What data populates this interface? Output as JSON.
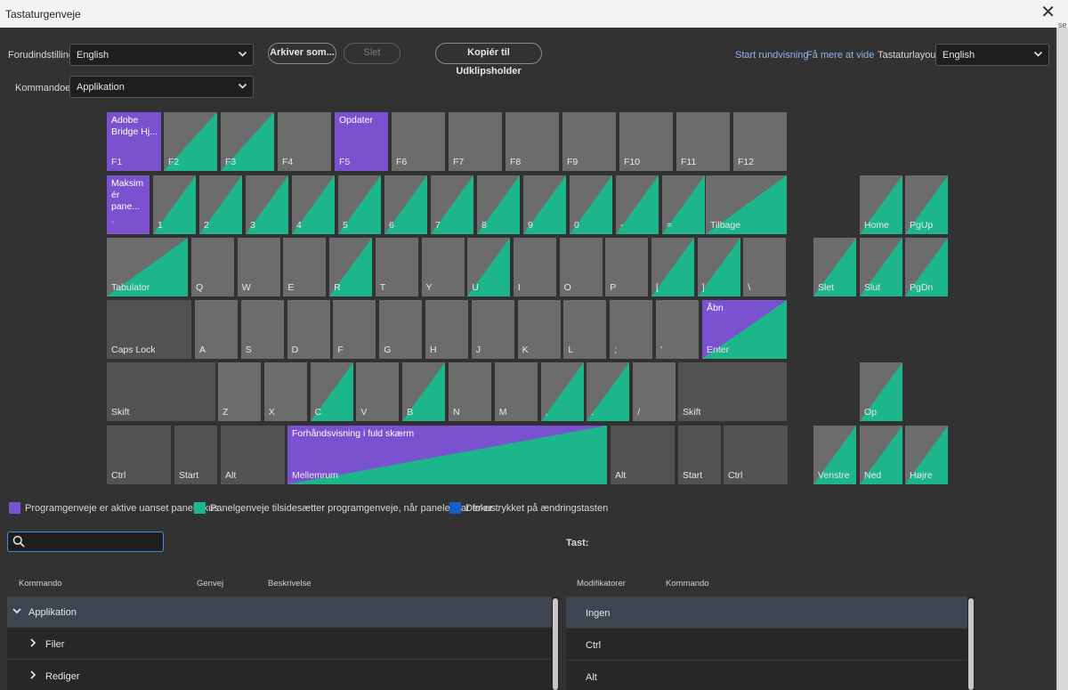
{
  "window": {
    "title": "Tastaturgenveje",
    "edge_text": "se"
  },
  "toolbar": {
    "preset_label": "Forudindstilling:",
    "preset_value": "English",
    "save_as_label": "Arkiver som...",
    "delete_label": "Slet",
    "copy_label": "Kopiér til Udklipsholder",
    "tour_link": "Start rundvisning",
    "learn_more_link": "Få mere at vide",
    "layout_label": "Tastaturlayout:",
    "layout_value": "English",
    "commands_label": "Kommandoer:",
    "commands_value": "Applikation"
  },
  "colors": {
    "app": "#7a52d0",
    "panel": "#1db58c",
    "modifier": "#1560c8",
    "key": "#6c6c6c",
    "key_dark": "#525252"
  },
  "keyboard": {
    "keys": [
      {
        "name": "key-f1",
        "label": "F1",
        "type": "app",
        "cmd": "Adobe Bridge Hj..."
      },
      {
        "name": "key-f2",
        "label": "F2",
        "type": "panel"
      },
      {
        "name": "key-f3",
        "label": "F3",
        "type": "panel"
      },
      {
        "name": "key-f4",
        "label": "F4",
        "type": "none"
      },
      {
        "name": "key-f5",
        "label": "F5",
        "type": "app",
        "cmd": "Opdater"
      },
      {
        "name": "key-f6",
        "label": "F6",
        "type": "none"
      },
      {
        "name": "key-f7",
        "label": "F7",
        "type": "none"
      },
      {
        "name": "key-f8",
        "label": "F8",
        "type": "none"
      },
      {
        "name": "key-f9",
        "label": "F9",
        "type": "none"
      },
      {
        "name": "key-f10",
        "label": "F10",
        "type": "none"
      },
      {
        "name": "key-f11",
        "label": "F11",
        "type": "none"
      },
      {
        "name": "key-f12",
        "label": "F12",
        "type": "none"
      },
      {
        "name": "key-backtick",
        "label": "`",
        "type": "app",
        "cmd": "Maksim ér pane..."
      },
      {
        "name": "key-1",
        "label": "1",
        "type": "panel"
      },
      {
        "name": "key-2",
        "label": "2",
        "type": "panel"
      },
      {
        "name": "key-3",
        "label": "3",
        "type": "panel"
      },
      {
        "name": "key-4",
        "label": "4",
        "type": "panel"
      },
      {
        "name": "key-5",
        "label": "5",
        "type": "panel"
      },
      {
        "name": "key-6",
        "label": "6",
        "type": "panel"
      },
      {
        "name": "key-7",
        "label": "7",
        "type": "panel"
      },
      {
        "name": "key-8",
        "label": "8",
        "type": "panel"
      },
      {
        "name": "key-9",
        "label": "9",
        "type": "panel"
      },
      {
        "name": "key-0",
        "label": "0",
        "type": "panel"
      },
      {
        "name": "key-minus",
        "label": "-",
        "type": "panel"
      },
      {
        "name": "key-equals",
        "label": "=",
        "type": "panel"
      },
      {
        "name": "key-backspace",
        "label": "Tilbage",
        "type": "panel"
      },
      {
        "name": "key-home",
        "label": "Home",
        "type": "panel"
      },
      {
        "name": "key-pgup",
        "label": "PgUp",
        "type": "panel"
      },
      {
        "name": "key-tab",
        "label": "Tabulator",
        "type": "panel"
      },
      {
        "name": "key-q",
        "label": "Q",
        "type": "none"
      },
      {
        "name": "key-w",
        "label": "W",
        "type": "none"
      },
      {
        "name": "key-e",
        "label": "E",
        "type": "none"
      },
      {
        "name": "key-r",
        "label": "R",
        "type": "panel"
      },
      {
        "name": "key-t",
        "label": "T",
        "type": "none"
      },
      {
        "name": "key-y",
        "label": "Y",
        "type": "none"
      },
      {
        "name": "key-u",
        "label": "U",
        "type": "panel"
      },
      {
        "name": "key-i",
        "label": "I",
        "type": "none"
      },
      {
        "name": "key-o",
        "label": "O",
        "type": "none"
      },
      {
        "name": "key-p",
        "label": "P",
        "type": "none"
      },
      {
        "name": "key-lbracket",
        "label": "[",
        "type": "panel"
      },
      {
        "name": "key-rbracket",
        "label": "]",
        "type": "panel"
      },
      {
        "name": "key-backslash",
        "label": "\\",
        "type": "none"
      },
      {
        "name": "key-delete",
        "label": "Slet",
        "type": "panel"
      },
      {
        "name": "key-end",
        "label": "Slut",
        "type": "panel"
      },
      {
        "name": "key-pgdn",
        "label": "PgDn",
        "type": "panel"
      },
      {
        "name": "key-capslock",
        "label": "Caps Lock",
        "type": "dark"
      },
      {
        "name": "key-a",
        "label": "A",
        "type": "none"
      },
      {
        "name": "key-s",
        "label": "S",
        "type": "none"
      },
      {
        "name": "key-d",
        "label": "D",
        "type": "none"
      },
      {
        "name": "key-f",
        "label": "F",
        "type": "none"
      },
      {
        "name": "key-g",
        "label": "G",
        "type": "none"
      },
      {
        "name": "key-h",
        "label": "H",
        "type": "none"
      },
      {
        "name": "key-j",
        "label": "J",
        "type": "none"
      },
      {
        "name": "key-k",
        "label": "K",
        "type": "none"
      },
      {
        "name": "key-l",
        "label": "L",
        "type": "none"
      },
      {
        "name": "key-semicolon",
        "label": ";",
        "type": "none"
      },
      {
        "name": "key-quote",
        "label": "'",
        "type": "none"
      },
      {
        "name": "key-enter",
        "label": "Enter",
        "type": "both",
        "cmd": "Åbn"
      },
      {
        "name": "key-shift-left",
        "label": "Skift",
        "type": "dark"
      },
      {
        "name": "key-z",
        "label": "Z",
        "type": "none"
      },
      {
        "name": "key-x",
        "label": "X",
        "type": "none"
      },
      {
        "name": "key-c",
        "label": "C",
        "type": "panel"
      },
      {
        "name": "key-v",
        "label": "V",
        "type": "none"
      },
      {
        "name": "key-b",
        "label": "B",
        "type": "panel"
      },
      {
        "name": "key-n",
        "label": "N",
        "type": "none"
      },
      {
        "name": "key-m",
        "label": "M",
        "type": "none"
      },
      {
        "name": "key-comma",
        "label": ",",
        "type": "panel"
      },
      {
        "name": "key-period",
        "label": ".",
        "type": "panel"
      },
      {
        "name": "key-slash",
        "label": "/",
        "type": "none"
      },
      {
        "name": "key-shift-right",
        "label": "Skift",
        "type": "dark"
      },
      {
        "name": "key-up",
        "label": "Op",
        "type": "panel"
      },
      {
        "name": "key-ctrl-left",
        "label": "Ctrl",
        "type": "dark"
      },
      {
        "name": "key-start-left",
        "label": "Start",
        "type": "dark"
      },
      {
        "name": "key-alt-left",
        "label": "Alt",
        "type": "dark"
      },
      {
        "name": "key-space",
        "label": "Mellemrum",
        "type": "both",
        "cmd": "Forhåndsvisning i fuld skærm"
      },
      {
        "name": "key-alt-right",
        "label": "Alt",
        "type": "dark"
      },
      {
        "name": "key-start-right",
        "label": "Start",
        "type": "dark"
      },
      {
        "name": "key-ctrl-right",
        "label": "Ctrl",
        "type": "dark"
      },
      {
        "name": "key-left",
        "label": "Venstre",
        "type": "panel"
      },
      {
        "name": "key-down",
        "label": "Ned",
        "type": "panel"
      },
      {
        "name": "key-right",
        "label": "Højre",
        "type": "panel"
      }
    ]
  },
  "legend": {
    "app": "Programgenveje er aktive uanset panelfokus",
    "panel": "Panelgenveje tilsidesætter programgenveje, når panelet har fokus",
    "modifier": "Der er trykket på ændringstasten"
  },
  "search": {
    "placeholder": ""
  },
  "key_label": "Tast:",
  "columns": {
    "command": "Kommando",
    "shortcut": "Genvej",
    "description": "Beskrivelse",
    "modifiers": "Modifikatorer",
    "mod_command": "Kommando"
  },
  "tree": [
    {
      "label": "Applikation",
      "expanded": true
    },
    {
      "label": "Filer",
      "expanded": false
    },
    {
      "label": "Rediger",
      "expanded": false
    }
  ],
  "modifiers": [
    "Ingen",
    "Ctrl",
    "Alt"
  ]
}
